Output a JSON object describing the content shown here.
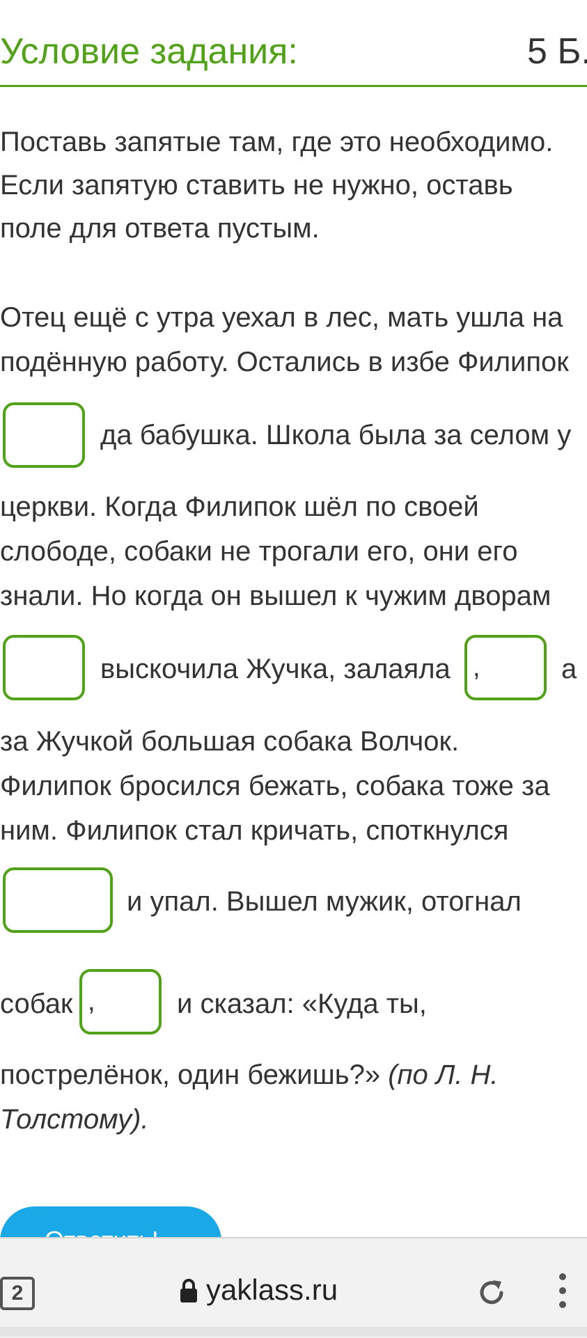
{
  "header": {
    "title": "Условие задания:",
    "score": "5 Б."
  },
  "instructions": [
    "Поставь запятые там, где это необходимо.",
    "Если запятую ставить не нужно, оставь",
    "поле для ответа пустым."
  ],
  "text": {
    "l1": "Отец ещё с утра уехал в лес, мать ушла на",
    "l2": "подённую работу. Остались в избе Филипок",
    "l3": "да бабушка. Школа была за селом у",
    "l4": "церкви. Когда Филипок шёл по своей",
    "l5": "слободе, собаки не трогали его, они его",
    "l6": "знали. Но когда он вышел к чужим дворам",
    "l7a": "выскочила Жучка, залаяла",
    "l7b": "а",
    "l8": "за Жучкой большая собака Волчок.",
    "l9": "Филипок бросился бежать, собака тоже за",
    "l10": "ним. Филипок стал кричать, споткнулся",
    "l11": "и упал. Вышел мужик, отогнал",
    "l12a": "собак",
    "l12b": "и сказал: «Куда ты,",
    "l13a": "пострелёнок, один бежишь?»",
    "l13b": "(по Л. Н.",
    "l14": "Толстому)."
  },
  "answers": {
    "a1": "",
    "a2": "",
    "a3": ",",
    "a4": "",
    "a5": ","
  },
  "button": {
    "label": "Ответить!"
  },
  "browser": {
    "tabs_count": "2",
    "url": "yaklass.ru",
    "icons": [
      "tabs-icon",
      "lock-icon",
      "reload-icon",
      "more-icon"
    ]
  },
  "colors": {
    "accent": "#51a218",
    "button": "#1aa9e6"
  }
}
